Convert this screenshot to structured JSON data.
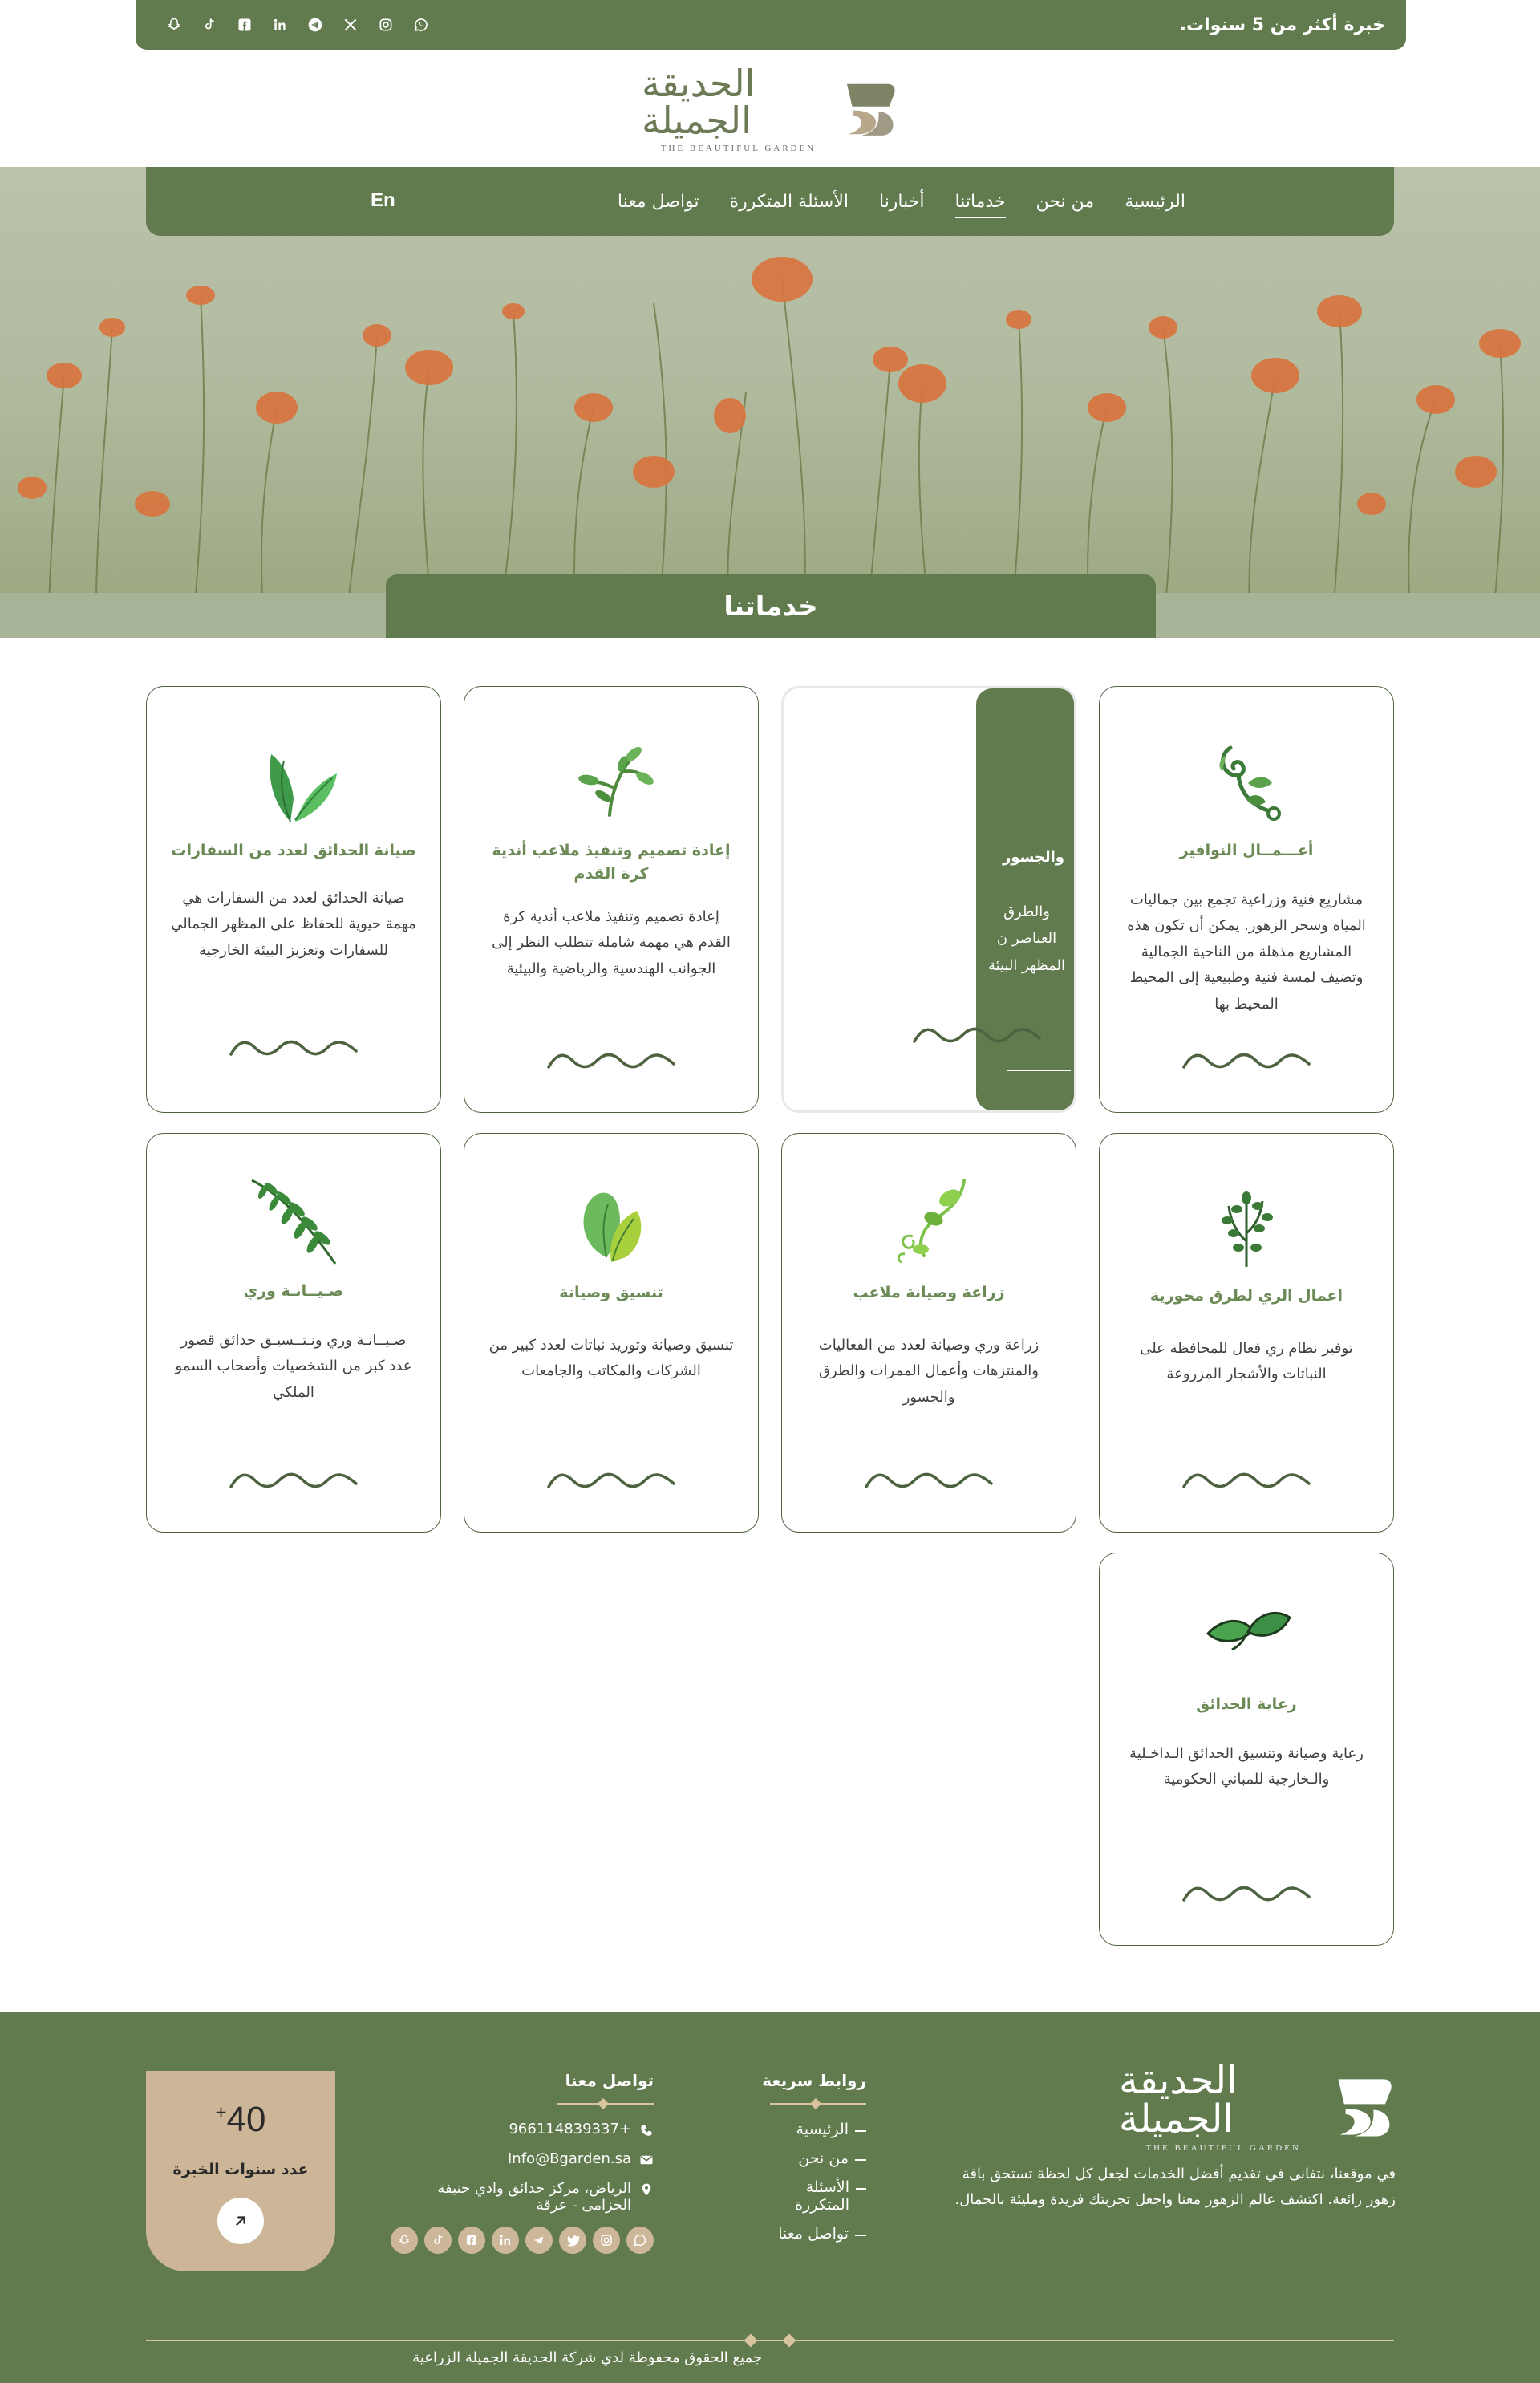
{
  "topbar": {
    "experience": "خبرة أكثر من 5 سنوات.",
    "social_icons": [
      "whatsapp-icon",
      "instagram-icon",
      "x-icon",
      "telegram-icon",
      "linkedin-icon",
      "facebook-icon",
      "tiktok-icon",
      "snapchat-icon"
    ]
  },
  "logo": {
    "arabic": "الحديقة الجميلة",
    "english": "THE BEAUTIFUL GARDEN"
  },
  "nav": {
    "items": [
      "الرئيسية",
      "من نحن",
      "خدماتنا",
      "أخبارنا",
      "الأسئلة المتكررة",
      "تواصل معنا"
    ],
    "active": "خدماتنا",
    "lang": "En"
  },
  "page_title": "خدماتنا",
  "cards": [
    {
      "title": "أعـــمــال النوافير",
      "desc": "مشاريع فنية وزراعية تجمع بين جماليات المياه وسحر الزهور. يمكن أن تكون هذه المشاريع مذهلة من الناحية الجمالية وتضيف لمسة فنية وطبيعية إلى المحيط المحيط بها",
      "icon": "vine-sprout-icon"
    },
    {
      "title": "والجسور",
      "desc": "والطرق العناصر ن المظهر البيئة",
      "icon": "path-bridge-icon"
    },
    {
      "title": "إعادة تصميم وتنفيذ ملاعب أندية كرة القدم",
      "desc": "إعادة تصميم وتنفيذ ملاعب أندية كرة القدم هي مهمة شاملة تتطلب النظر إلى الجوانب الهندسية والرياضية والبيئية",
      "icon": "branch-leaves-icon"
    },
    {
      "title": "صيانة الحدائق لعدد من السفارات",
      "desc": "صيانة الحدائق لعدد من السفارات هي مهمة حيوية للحفاظ على المظهر الجمالي للسفارات وتعزيز البيئة الخارجية",
      "icon": "banana-leaves-icon"
    },
    {
      "title": "اعمال الري لطرق محورية",
      "desc": "توفير نظام ري فعال للمحافظة على النباتات والأشجار المزروعة",
      "icon": "herb-plant-icon"
    },
    {
      "title": "زراعة وصيانة ملاعب",
      "desc": "زراعة وري وصيانة لعدد من الفعاليات والمنتزهات وأعمال الممرات والطرق والجسور",
      "icon": "curly-vine-icon"
    },
    {
      "title": "تنسيق وصيانة",
      "desc": "تنسيق وصيانة وتوريد نباتات لعدد كبير من الشركات والمكاتب والجامعات",
      "icon": "two-leaves-icon"
    },
    {
      "title": "صـيــانـة وري",
      "desc": "صـيــانـة وري ونـتــسيـق حدائق قصور عدد كبر من الشخصيات وأصحاب السمو الملكي",
      "icon": "fern-branch-icon"
    },
    {
      "title": "رعاية الحدائق",
      "desc": "رعاية وصيانة وتنسيق الحدائق الـداخـلية والـخارجية للمباني الحكومية",
      "icon": "leaf-pair-icon"
    }
  ],
  "footer": {
    "about": "في موقعنا، نتفانى في تقديم أفضل الخدمات لجعل كل لحظة تستحق باقة زهور رائعة. اكتشف عالم الزهور معنا واجعل تجربتك فريدة ومليئة بالجمال.",
    "links_title": "روابط سريعة",
    "links": [
      "الرئيسية",
      "من نحن",
      "الأسئلة المتكررة",
      "تواصل معنا"
    ],
    "contact_title": "تواصل معنا",
    "phone": "966114839337+",
    "email": "Info@Bgarden.sa",
    "address": "الرياض، مركز حدائق وادي حنيفة الخزامى - عرقة",
    "experience_number": "40",
    "experience_plus": "+",
    "experience_label": "عدد سنوات الخبرة",
    "copyright": "جميع الحقوق محفوظة لدي شركة الحديقة الجميلة الزراعية",
    "social_icons": [
      "whatsapp-icon",
      "instagram-icon",
      "twitter-icon",
      "telegram-icon",
      "linkedin-icon",
      "facebook-icon",
      "tiktok-icon",
      "snapchat-icon"
    ]
  },
  "colors": {
    "primary_green": "#617a4e",
    "card_title_green": "#6b8a56",
    "sand": "#cdb698",
    "hero_sage": "#a7b498"
  }
}
